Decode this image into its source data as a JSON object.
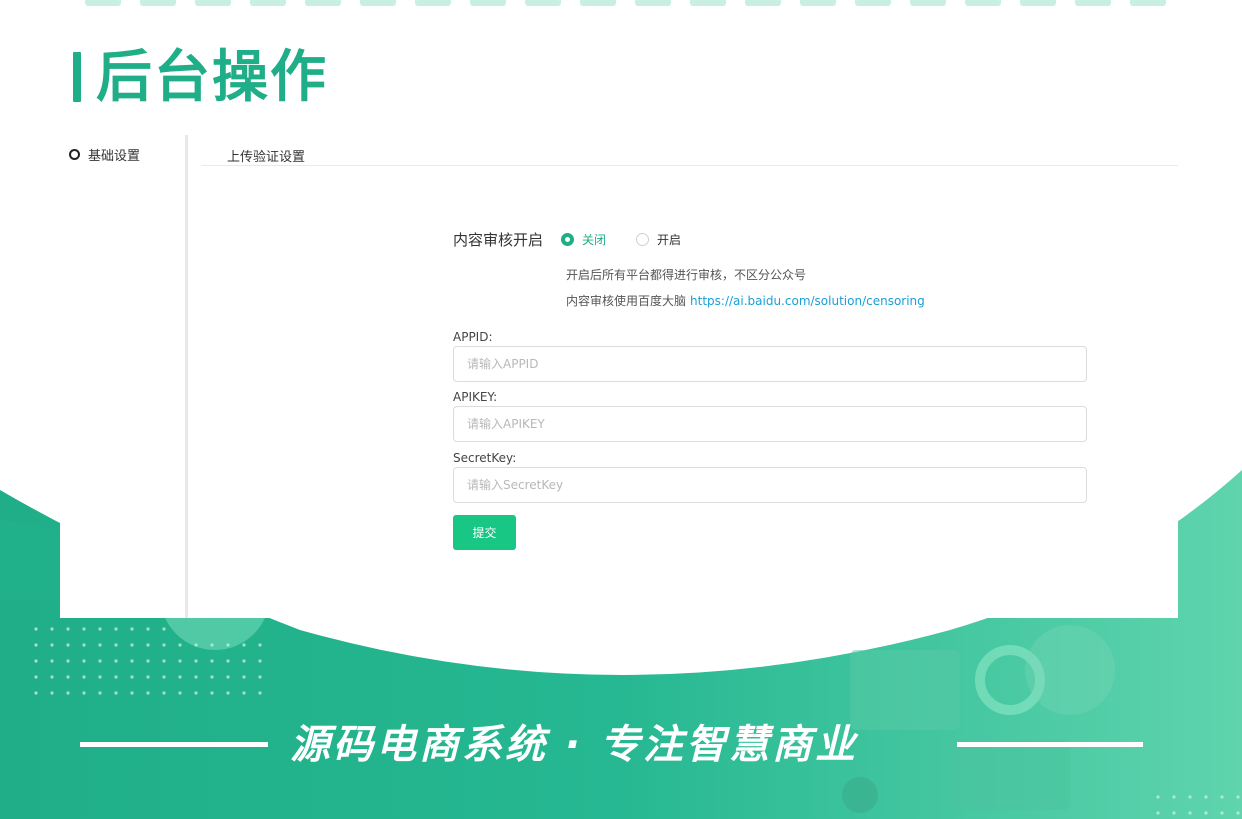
{
  "page_title": "后台操作",
  "sidebar": {
    "items": [
      {
        "label": "基础设置"
      }
    ]
  },
  "content": {
    "header": "上传验证设置",
    "audit": {
      "label": "内容审核开启",
      "options": [
        {
          "label": "关闭",
          "selected": true
        },
        {
          "label": "开启",
          "selected": false
        }
      ],
      "hint1": "开启后所有平台都得进行审核，不区分公众号",
      "hint2_prefix": "内容审核使用百度大脑",
      "hint2_link": "https://ai.baidu.com/solution/censoring"
    },
    "fields": [
      {
        "label": "APPID:",
        "placeholder": "请输入APPID",
        "value": ""
      },
      {
        "label": "APIKEY:",
        "placeholder": "请输入APIKEY",
        "value": ""
      },
      {
        "label": "SecretKey:",
        "placeholder": "请输入SecretKey",
        "value": ""
      }
    ],
    "submit_label": "提交"
  },
  "slogan": "源码电商系统 · 专注智慧商业",
  "colors": {
    "brand_green": "#1fae88",
    "button_green": "#17c783",
    "link_blue": "#1a9fd6",
    "wave_green": "#2bbf95"
  }
}
